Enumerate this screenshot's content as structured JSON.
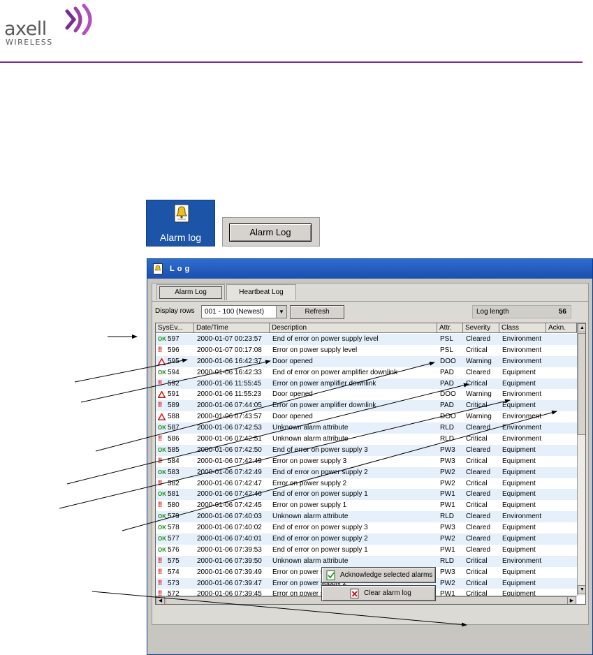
{
  "brand": {
    "name": "axell",
    "sub": "WIRELESS",
    "accent": "#7b2d8f"
  },
  "thumbnails": {
    "icon_button_label": "Alarm log",
    "tab_button_label": "Alarm Log"
  },
  "window": {
    "title": "Log",
    "tabs": [
      {
        "label": "Alarm Log",
        "active": true
      },
      {
        "label": "Heartbeat Log",
        "active": false
      }
    ],
    "display_rows_label": "Display rows",
    "display_rows_value": "001 - 100  (Newest)",
    "refresh_label": "Refresh",
    "log_length_label": "Log length",
    "log_length_value": "56",
    "columns": [
      "SysEv...",
      "Date/Time",
      "Description",
      "Attr.",
      "Severity",
      "Class",
      "Ackn."
    ],
    "rows": [
      {
        "icon": "ok",
        "id": "597",
        "date": "2000-01-07  00:23:57",
        "desc": "End of error on power supply level",
        "attr": "PSL",
        "sev": "Cleared",
        "cls": "Environment"
      },
      {
        "icon": "crit",
        "id": "596",
        "date": "2000-01-07  00:17:08",
        "desc": "Error on power supply level",
        "attr": "PSL",
        "sev": "Critical",
        "cls": "Environment"
      },
      {
        "icon": "warn",
        "id": "595",
        "date": "2000-01-06  16:42:37",
        "desc": "Door opened",
        "attr": "DOO",
        "sev": "Warning",
        "cls": "Environment"
      },
      {
        "icon": "ok",
        "id": "594",
        "date": "2000-01-06  16:42:33",
        "desc": "End of error on power amplifier downlink",
        "attr": "PAD",
        "sev": "Cleared",
        "cls": "Equipment"
      },
      {
        "icon": "crit",
        "id": "592",
        "date": "2000-01-06  11:55:45",
        "desc": "Error on power amplifier downlink",
        "attr": "PAD",
        "sev": "Critical",
        "cls": "Equipment"
      },
      {
        "icon": "warn",
        "id": "591",
        "date": "2000-01-06  11:55:23",
        "desc": "Door opened",
        "attr": "DOO",
        "sev": "Warning",
        "cls": "Environment"
      },
      {
        "icon": "crit",
        "id": "589",
        "date": "2000-01-06  07:44:05",
        "desc": "Error on power amplifier downlink",
        "attr": "PAD",
        "sev": "Critical",
        "cls": "Equipment"
      },
      {
        "icon": "warn",
        "id": "588",
        "date": "2000-01-06  07:43:57",
        "desc": "Door opened",
        "attr": "DOO",
        "sev": "Warning",
        "cls": "Environment"
      },
      {
        "icon": "ok",
        "id": "587",
        "date": "2000-01-06  07:42:53",
        "desc": "Unknown alarm attribute",
        "attr": "RLD",
        "sev": "Cleared",
        "cls": "Environment"
      },
      {
        "icon": "crit",
        "id": "586",
        "date": "2000-01-06  07:42:51",
        "desc": "Unknown alarm attribute",
        "attr": "RLD",
        "sev": "Critical",
        "cls": "Environment"
      },
      {
        "icon": "ok",
        "id": "585",
        "date": "2000-01-06  07:42:50",
        "desc": "End of error on power supply 3",
        "attr": "PW3",
        "sev": "Cleared",
        "cls": "Equipment"
      },
      {
        "icon": "crit",
        "id": "584",
        "date": "2000-01-06  07:42:49",
        "desc": "Error on power supply 3",
        "attr": "PW3",
        "sev": "Critical",
        "cls": "Equipment"
      },
      {
        "icon": "ok",
        "id": "583",
        "date": "2000-01-06  07:42:49",
        "desc": "End of error on power supply 2",
        "attr": "PW2",
        "sev": "Cleared",
        "cls": "Equipment"
      },
      {
        "icon": "crit",
        "id": "582",
        "date": "2000-01-06  07:42:47",
        "desc": "Error on power supply 2",
        "attr": "PW2",
        "sev": "Critical",
        "cls": "Equipment"
      },
      {
        "icon": "ok",
        "id": "581",
        "date": "2000-01-06  07:42:46",
        "desc": "End of error on power supply 1",
        "attr": "PW1",
        "sev": "Cleared",
        "cls": "Equipment"
      },
      {
        "icon": "crit",
        "id": "580",
        "date": "2000-01-06  07:42:45",
        "desc": "Error on power supply 1",
        "attr": "PW1",
        "sev": "Critical",
        "cls": "Equipment"
      },
      {
        "icon": "ok",
        "id": "579",
        "date": "2000-01-06  07:40:03",
        "desc": "Unknown alarm attribute",
        "attr": "RLD",
        "sev": "Cleared",
        "cls": "Environment"
      },
      {
        "icon": "ok",
        "id": "578",
        "date": "2000-01-06  07:40:02",
        "desc": "End of error on power supply 3",
        "attr": "PW3",
        "sev": "Cleared",
        "cls": "Equipment"
      },
      {
        "icon": "ok",
        "id": "577",
        "date": "2000-01-06  07:40:01",
        "desc": "End of error on power supply 2",
        "attr": "PW2",
        "sev": "Cleared",
        "cls": "Equipment"
      },
      {
        "icon": "ok",
        "id": "576",
        "date": "2000-01-06  07:39:53",
        "desc": "End of error on power supply 1",
        "attr": "PW1",
        "sev": "Cleared",
        "cls": "Equipment"
      },
      {
        "icon": "crit",
        "id": "575",
        "date": "2000-01-06  07:39:50",
        "desc": "Unknown alarm attribute",
        "attr": "RLD",
        "sev": "Critical",
        "cls": "Environment"
      },
      {
        "icon": "crit",
        "id": "574",
        "date": "2000-01-06  07:39:49",
        "desc": "Error on power supply 3",
        "attr": "PW3",
        "sev": "Critical",
        "cls": "Equipment"
      },
      {
        "icon": "crit",
        "id": "573",
        "date": "2000-01-06  07:39:47",
        "desc": "Error on power supply 2",
        "attr": "PW2",
        "sev": "Critical",
        "cls": "Equipment"
      },
      {
        "icon": "crit",
        "id": "572",
        "date": "2000-01-06  07:39:45",
        "desc": "Error on power supply 1",
        "attr": "PW1",
        "sev": "Critical",
        "cls": "Equipment"
      }
    ],
    "ack_button_label": "Acknowledge selected alarms",
    "clear_button_label": "Clear alarm log"
  }
}
